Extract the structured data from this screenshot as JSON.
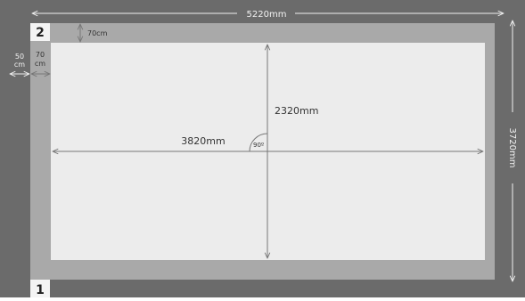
{
  "colors": {
    "outer_band": "#6b6b6b",
    "inner_band": "#a9a9a9",
    "field": "#ececec",
    "marker_box": "#f4f4f4",
    "lines": "#777777"
  },
  "markers": {
    "top": "2",
    "bottom": "1"
  },
  "dimensions": {
    "total_width": "5220mm",
    "total_height": "3720mm",
    "field_width": "3820mm",
    "field_height": "2320mm",
    "inner_margin_top": "70cm",
    "outer_margin_left_value": "50",
    "outer_margin_left_unit": "cm",
    "inner_margin_left_value": "70",
    "inner_margin_left_unit": "cm",
    "angle": "90º"
  }
}
